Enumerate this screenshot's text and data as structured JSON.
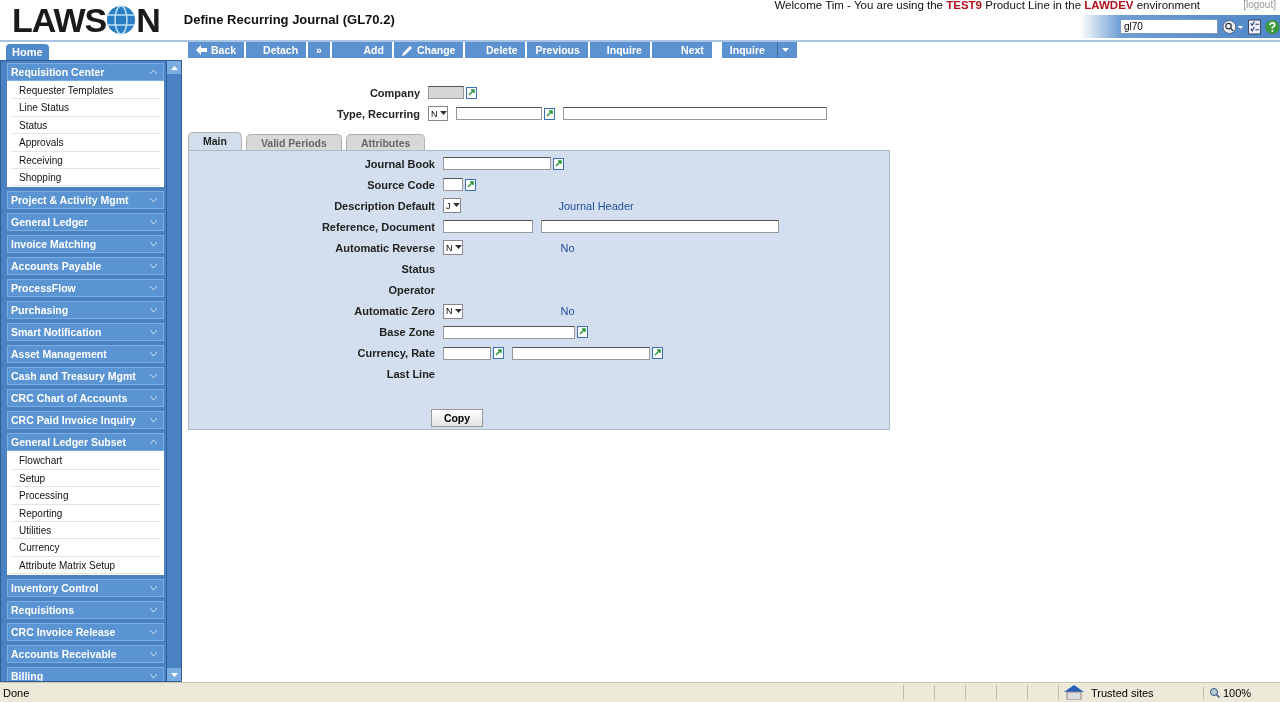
{
  "header": {
    "logo_start": "LAWS",
    "logo_end": "N",
    "title": "Define Recurring Journal (GL70.2)",
    "welcome": "Welcome Tim - You are using the **TEST9** Product Line in the **LAWDEV** environment",
    "logout": "[logout]",
    "search_value": "gl70"
  },
  "home_tab": "Home",
  "sidebar": [
    {
      "label": "Requisition Center",
      "expanded": true,
      "items": [
        "Requester Templates",
        "Line Status",
        "Status",
        "Approvals",
        "Receiving",
        "Shopping"
      ]
    },
    {
      "label": "Project & Activity Mgmt",
      "expanded": false
    },
    {
      "label": "General Ledger",
      "expanded": false
    },
    {
      "label": "Invoice Matching",
      "expanded": false
    },
    {
      "label": "Accounts Payable",
      "expanded": false
    },
    {
      "label": "ProcessFlow",
      "expanded": false
    },
    {
      "label": "Purchasing",
      "expanded": false
    },
    {
      "label": "Smart Notification",
      "expanded": false
    },
    {
      "label": "Asset Management",
      "expanded": false
    },
    {
      "label": "Cash and Treasury Mgmt",
      "expanded": false
    },
    {
      "label": "CRC Chart of Accounts",
      "expanded": false
    },
    {
      "label": "CRC Paid Invoice Inquiry",
      "expanded": false
    },
    {
      "label": "General Ledger Subset",
      "expanded": true,
      "items": [
        "Flowchart",
        "Setup",
        "Processing",
        "Reporting",
        "Utilities",
        "Currency",
        "Attribute Matrix Setup"
      ]
    },
    {
      "label": "Inventory Control",
      "expanded": false
    },
    {
      "label": "Requisitions",
      "expanded": false
    },
    {
      "label": "CRC Invoice Release",
      "expanded": false
    },
    {
      "label": "Accounts Receivable",
      "expanded": false
    },
    {
      "label": "Billing",
      "expanded": false
    }
  ],
  "toolbar": [
    {
      "label": "Back",
      "kind": "back"
    },
    {
      "label": "Detach",
      "kind": "plain"
    },
    {
      "label": "»",
      "kind": "plain"
    },
    {
      "label": "Add",
      "kind": "plain"
    },
    {
      "label": "Change",
      "kind": "edit"
    },
    {
      "label": "Delete",
      "kind": "plain"
    },
    {
      "label": "Previous",
      "kind": "plain"
    },
    {
      "label": "Inquire",
      "kind": "plain"
    },
    {
      "label": "Next",
      "kind": "plain"
    },
    {
      "label": "Inquire",
      "kind": "dropdown"
    }
  ],
  "header_fields": [
    {
      "label": "Company",
      "controls": [
        {
          "kind": "lookup",
          "disabled": true
        }
      ]
    },
    {
      "label": "Type, Recurring",
      "controls": [
        {
          "kind": "select",
          "value": "N"
        },
        {
          "kind": "lookup"
        },
        {
          "kind": "input"
        }
      ]
    }
  ],
  "tabs": [
    {
      "label": "Main",
      "selected": true
    },
    {
      "label": "Valid Periods",
      "selected": false
    },
    {
      "label": "Attributes",
      "selected": false
    }
  ],
  "main_fields": [
    {
      "label": "Journal Book",
      "controls": [
        {
          "kind": "lookup"
        }
      ]
    },
    {
      "label": "Source Code",
      "controls": [
        {
          "kind": "lookup"
        }
      ]
    },
    {
      "label": "Description Default",
      "controls": [
        {
          "kind": "select",
          "value": "J"
        }
      ],
      "note": "Journal Header"
    },
    {
      "label": "Reference, Document",
      "controls": [
        {
          "kind": "input"
        },
        {
          "kind": "input"
        }
      ]
    },
    {
      "label": "Automatic Reverse",
      "controls": [
        {
          "kind": "select",
          "value": "N"
        }
      ],
      "note": "No"
    },
    {
      "label": "Status"
    },
    {
      "label": "Operator"
    },
    {
      "label": "Automatic Zero",
      "controls": [
        {
          "kind": "select",
          "value": "N"
        }
      ],
      "note": "No"
    },
    {
      "label": "Base Zone",
      "controls": [
        {
          "kind": "lookup"
        }
      ]
    },
    {
      "label": "Currency, Rate",
      "controls": [
        {
          "kind": "lookup"
        },
        {
          "kind": "lookup"
        }
      ]
    },
    {
      "label": "Last Line"
    }
  ],
  "copy_button": "Copy",
  "status_bar": {
    "status": "Done",
    "zone": "Trusted sites",
    "zoom": "100%"
  }
}
